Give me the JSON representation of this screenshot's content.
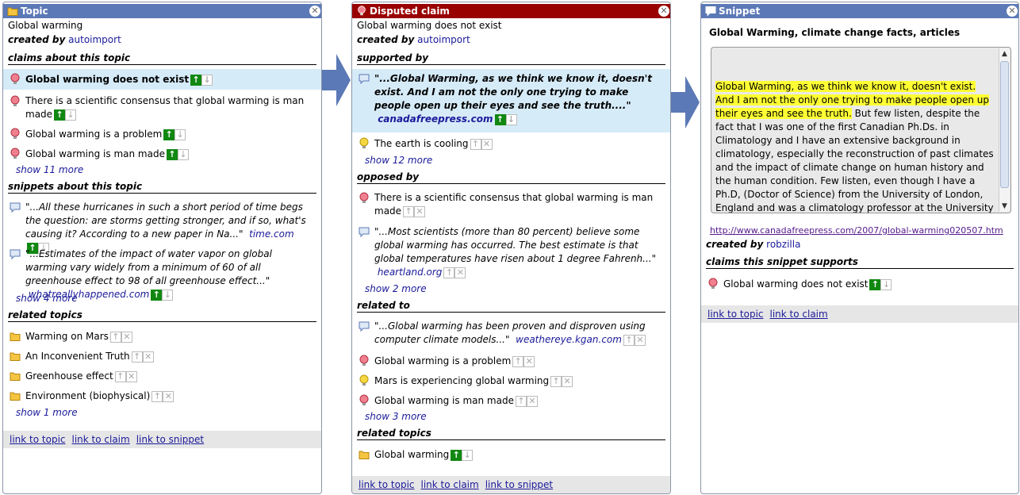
{
  "colors": {
    "tab_blue": "#5b79b6",
    "tab_red": "#990000",
    "highlight_row": "#d6ebf8",
    "link": "#1a1a9a",
    "vote_up": "#118811",
    "snippet_highlight": "#ffff33"
  },
  "topic_panel": {
    "tab_title": "Topic",
    "title": "Global warming",
    "created_by_label": "created by",
    "created_by_user": "autoimport",
    "claims_header": "claims about this topic",
    "claims": [
      {
        "text": "Global warming does not exist",
        "icon": "disputed-bulb-icon"
      },
      {
        "text": "There is a scientific consensus that global warming is man made",
        "icon": "disputed-bulb-icon"
      },
      {
        "text": "Global warming is a problem",
        "icon": "disputed-bulb-icon"
      },
      {
        "text": "Global warming is man made",
        "icon": "disputed-bulb-icon"
      }
    ],
    "claims_more": "show 11 more",
    "snippets_header": "snippets about this topic",
    "snippets": [
      {
        "text": "\"...All these hurricanes in such a short period of time begs the question: are storms getting stronger, and if so, what's causing it? According to a new paper in Na...\"",
        "source": "time.com"
      },
      {
        "text": "\"...Estimates of the impact of water vapor on global warming vary widely from a minimum of 60 of all greenhouse effect to 98 of all greenhouse effect...\"",
        "source": "whatreallyhappened.com"
      }
    ],
    "snippets_more": "show 4 more",
    "related_header": "related topics",
    "related": [
      "Warming on Mars",
      "An Inconvenient Truth",
      "Greenhouse effect",
      "Environment (biophysical)"
    ],
    "related_more": "show 1 more",
    "footer": {
      "link_topic": "link to topic",
      "link_claim": "link to claim",
      "link_snippet": "link to snippet"
    }
  },
  "claim_panel": {
    "tab_title": "Disputed claim",
    "title": "Global warming does not exist",
    "created_by_label": "created by",
    "created_by_user": "autoimport",
    "supported_header": "supported by",
    "supported_snippet": {
      "text": "\"...Global Warming, as we think we know it, doesn't exist. And I am not the only one trying to make people open up their eyes and see the truth....\"",
      "source": "canadafreepress.com"
    },
    "supported_claim": "The earth is cooling",
    "supported_more": "show 12 more",
    "opposed_header": "opposed by",
    "opposed_claim": "There is a scientific consensus that global warming is man made",
    "opposed_snippet": {
      "text": "\"...Most scientists (more than 80 percent) believe some global warming has occurred. The best estimate is that global temperatures have risen about 1 degree Fahrenh...\"",
      "source": "heartland.org"
    },
    "opposed_more": "show 2 more",
    "related_to_header": "related to",
    "related_snippet": {
      "text": "\"...Global warming has been proven and disproven using computer climate models...\"",
      "source": "weathereye.kgan.com"
    },
    "related_claims": [
      "Global warming is a problem",
      "Mars is experiencing global warming",
      "Global warming is man made"
    ],
    "related_more": "show 3 more",
    "related_topics_header": "related topics",
    "related_topic": "Global warming",
    "footer": {
      "link_topic": "link to topic",
      "link_claim": "link to claim",
      "link_snippet": "link to snippet"
    }
  },
  "snippet_panel": {
    "tab_title": "Snippet",
    "title": "Global Warming, climate change facts, articles",
    "highlight": "Global Warming, as we think we know it, doesn't exist. And I am not the only one trying to make people open up their eyes and see the truth.",
    "body": " But few listen, despite the fact that I was one of the first Canadian Ph.Ds. in Climatology and I have an extensive background in climatology, especially the reconstruction of past climates and the impact of climate change on human history and the human condition. Few listen, even though I have a Ph.D, (Doctor of Science) from the University of London, England and was a climatology professor at the University of Winnipeg. For some reason",
    "url": "http://www.canadafreepress.com/2007/global-warming020507.htm",
    "created_by_label": "created by",
    "created_by_user": "robzilla",
    "supports_header": "claims this snippet supports",
    "supports_claim": "Global warming does not exist",
    "footer": {
      "link_topic": "link to topic",
      "link_claim": "link to claim"
    }
  }
}
